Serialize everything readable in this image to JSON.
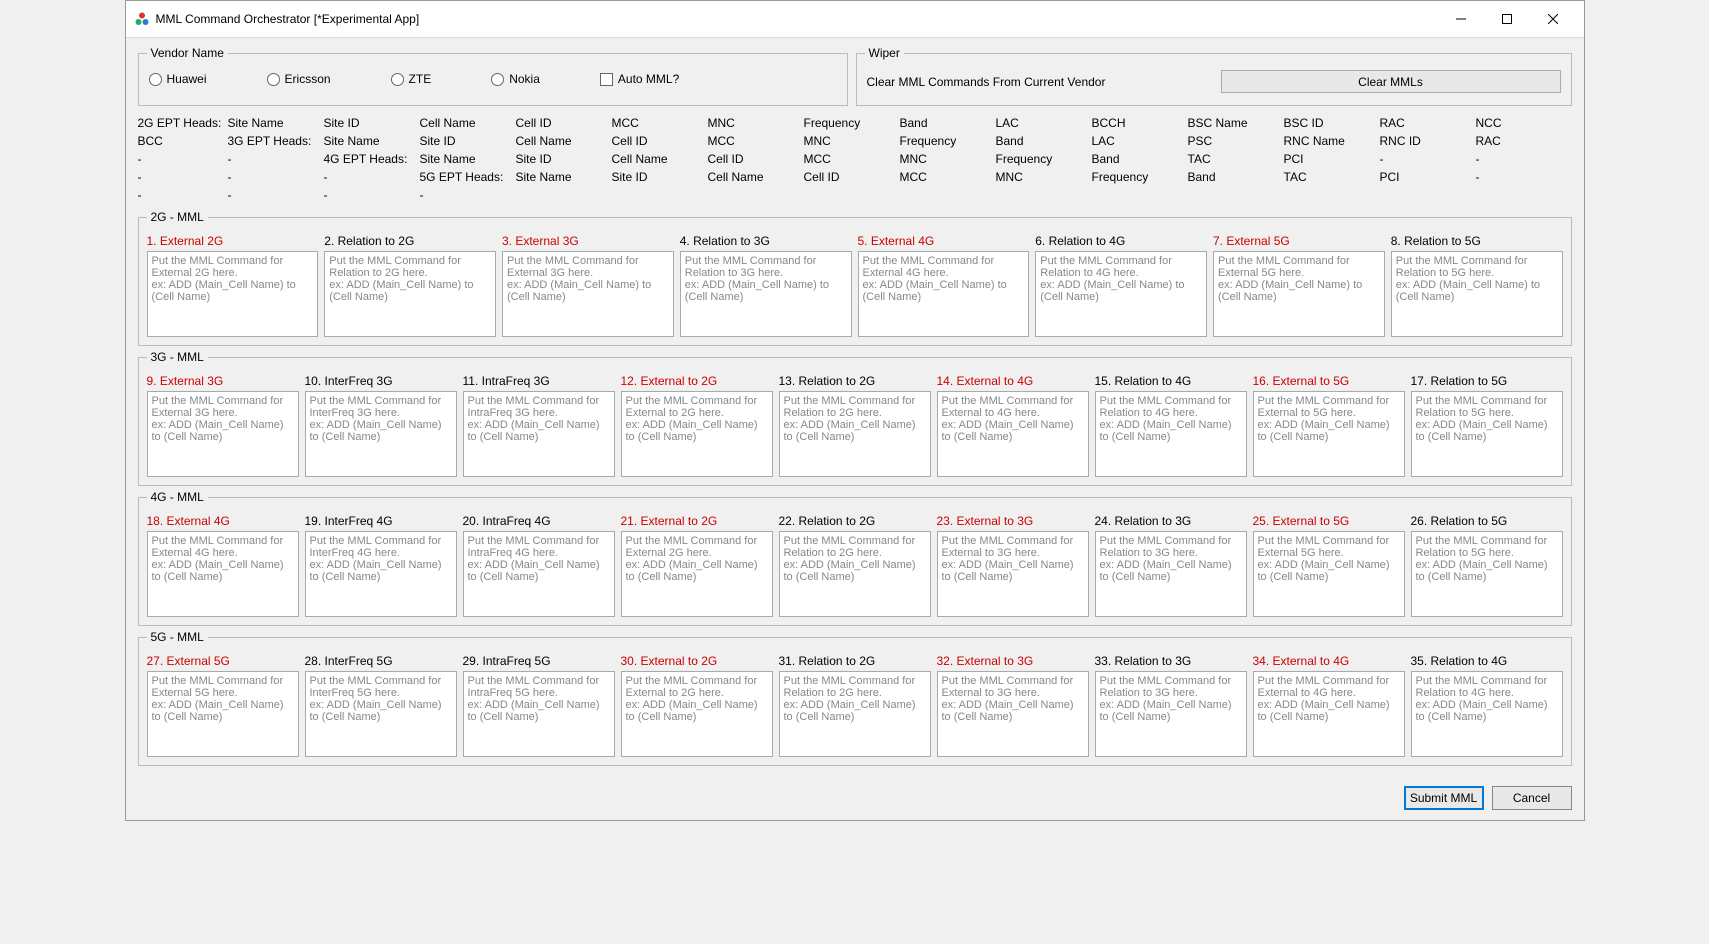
{
  "window": {
    "title": "MML Command Orchestrator [*Experimental App]"
  },
  "vendor": {
    "legend": "Vendor Name",
    "options": [
      "Huawei",
      "Ericsson",
      "ZTE",
      "Nokia"
    ],
    "auto_label": "Auto MML?"
  },
  "wiper": {
    "legend": "Wiper",
    "text": "Clear MML Commands From Current Vendor",
    "button": "Clear MMLs"
  },
  "heads": {
    "rows": [
      {
        "label": "2G EPT Heads:",
        "cols": [
          "Site Name",
          "Site ID",
          "Cell Name",
          "Cell ID",
          "MCC",
          "MNC",
          "Frequency",
          "Band",
          "LAC",
          "BCCH",
          "BSC Name",
          "BSC ID",
          "RAC",
          "NCC",
          "BCC"
        ]
      },
      {
        "label": "3G EPT Heads:",
        "cols": [
          "Site Name",
          "Site ID",
          "Cell Name",
          "Cell ID",
          "MCC",
          "MNC",
          "Frequency",
          "Band",
          "LAC",
          "PSC",
          "RNC Name",
          "RNC ID",
          "RAC",
          "-",
          "-"
        ]
      },
      {
        "label": "4G EPT Heads:",
        "cols": [
          "Site Name",
          "Site ID",
          "Cell Name",
          "Cell ID",
          "MCC",
          "MNC",
          "Frequency",
          "Band",
          "TAC",
          "PCI",
          "-",
          "-",
          "-",
          "-",
          "-"
        ]
      },
      {
        "label": "5G EPT Heads:",
        "cols": [
          "Site Name",
          "Site ID",
          "Cell Name",
          "Cell ID",
          "MCC",
          "MNC",
          "Frequency",
          "Band",
          "TAC",
          "PCI",
          "-",
          "-",
          "-",
          "-",
          "-"
        ]
      }
    ]
  },
  "sections": [
    {
      "legend": "2G - MML",
      "items": [
        {
          "label": "1. External 2G",
          "red": true,
          "placeholder": "Put the MML Command for External 2G here.\nex: ADD (Main_Cell Name) to (Cell Name)"
        },
        {
          "label": "2. Relation to 2G",
          "red": false,
          "placeholder": "Put the MML Command for Relation to 2G here.\nex: ADD (Main_Cell Name) to (Cell Name)"
        },
        {
          "label": "3. External 3G",
          "red": true,
          "placeholder": "Put the MML Command for External 3G here.\nex: ADD (Main_Cell Name) to (Cell Name)"
        },
        {
          "label": "4. Relation to 3G",
          "red": false,
          "placeholder": "Put the MML Command for Relation to 3G here.\nex: ADD (Main_Cell Name) to (Cell Name)"
        },
        {
          "label": "5. External 4G",
          "red": true,
          "placeholder": "Put the MML Command for External 4G here.\nex: ADD (Main_Cell Name) to (Cell Name)"
        },
        {
          "label": "6. Relation to 4G",
          "red": false,
          "placeholder": "Put the MML Command for Relation to 4G here.\nex: ADD (Main_Cell Name) to (Cell Name)"
        },
        {
          "label": "7. External 5G",
          "red": true,
          "placeholder": "Put the MML Command for External 5G here.\nex: ADD (Main_Cell Name) to (Cell Name)"
        },
        {
          "label": "8. Relation to 5G",
          "red": false,
          "placeholder": "Put the MML Command for Relation to 5G here.\nex: ADD (Main_Cell Name) to (Cell Name)"
        }
      ]
    },
    {
      "legend": "3G - MML",
      "items": [
        {
          "label": "9. External 3G",
          "red": true,
          "placeholder": "Put the MML Command for External 3G here.\nex: ADD (Main_Cell Name) to (Cell Name)"
        },
        {
          "label": "10. InterFreq 3G",
          "red": false,
          "placeholder": "Put the MML Command for InterFreq 3G here.\nex: ADD (Main_Cell Name) to (Cell Name)"
        },
        {
          "label": "11. IntraFreq 3G",
          "red": false,
          "placeholder": "Put the MML Command for IntraFreq 3G here.\nex: ADD (Main_Cell Name) to (Cell Name)"
        },
        {
          "label": "12. External to 2G",
          "red": true,
          "placeholder": "Put the MML Command for External to 2G here.\nex: ADD (Main_Cell Name) to (Cell Name)"
        },
        {
          "label": "13. Relation to 2G",
          "red": false,
          "placeholder": "Put the MML Command for Relation to 2G here.\nex: ADD (Main_Cell Name) to (Cell Name)"
        },
        {
          "label": "14. External to 4G",
          "red": true,
          "placeholder": "Put the MML Command for External to 4G here.\nex: ADD (Main_Cell Name) to (Cell Name)"
        },
        {
          "label": "15. Relation to 4G",
          "red": false,
          "placeholder": "Put the MML Command for Relation to 4G here.\nex: ADD (Main_Cell Name) to (Cell Name)"
        },
        {
          "label": "16. External to 5G",
          "red": true,
          "placeholder": "Put the MML Command for External to 5G here.\nex: ADD (Main_Cell Name) to (Cell Name)"
        },
        {
          "label": "17. Relation to 5G",
          "red": false,
          "placeholder": "Put the MML Command for Relation to 5G here.\nex: ADD (Main_Cell Name) to (Cell Name)"
        }
      ]
    },
    {
      "legend": "4G - MML",
      "items": [
        {
          "label": "18. External 4G",
          "red": true,
          "placeholder": "Put the MML Command for External 4G here.\nex: ADD (Main_Cell Name) to (Cell Name)"
        },
        {
          "label": "19. InterFreq 4G",
          "red": false,
          "placeholder": "Put the MML Command for InterFreq 4G here.\nex: ADD (Main_Cell Name) to (Cell Name)"
        },
        {
          "label": "20. IntraFreq 4G",
          "red": false,
          "placeholder": "Put the MML Command for IntraFreq 4G here.\nex: ADD (Main_Cell Name) to (Cell Name)"
        },
        {
          "label": "21. External to 2G",
          "red": true,
          "placeholder": "Put the MML Command for External 2G here.\nex: ADD (Main_Cell Name) to (Cell Name)"
        },
        {
          "label": "22. Relation to 2G",
          "red": false,
          "placeholder": "Put the MML Command for Relation to 2G here.\nex: ADD (Main_Cell Name) to (Cell Name)"
        },
        {
          "label": "23. External to 3G",
          "red": true,
          "placeholder": "Put the MML Command for External to 3G here.\nex: ADD (Main_Cell Name) to (Cell Name)"
        },
        {
          "label": "24. Relation to 3G",
          "red": false,
          "placeholder": "Put the MML Command for Relation to 3G here.\nex: ADD (Main_Cell Name) to (Cell Name)"
        },
        {
          "label": "25. External to 5G",
          "red": true,
          "placeholder": "Put the MML Command for External 5G here.\nex: ADD (Main_Cell Name) to (Cell Name)"
        },
        {
          "label": "26. Relation to 5G",
          "red": false,
          "placeholder": "Put the MML Command for Relation to 5G here.\nex: ADD (Main_Cell Name) to (Cell Name)"
        }
      ]
    },
    {
      "legend": "5G - MML",
      "items": [
        {
          "label": "27. External 5G",
          "red": true,
          "placeholder": "Put the MML Command for External 5G here.\nex: ADD (Main_Cell Name) to (Cell Name)"
        },
        {
          "label": "28. InterFreq 5G",
          "red": false,
          "placeholder": "Put the MML Command for InterFreq 5G here.\nex: ADD (Main_Cell Name) to (Cell Name)"
        },
        {
          "label": "29. IntraFreq 5G",
          "red": false,
          "placeholder": "Put the MML Command for IntraFreq 5G here.\nex: ADD (Main_Cell Name) to (Cell Name)"
        },
        {
          "label": "30. External to 2G",
          "red": true,
          "placeholder": "Put the MML Command for External to 2G here.\nex: ADD (Main_Cell Name) to (Cell Name)"
        },
        {
          "label": "31. Relation to 2G",
          "red": false,
          "placeholder": "Put the MML Command for Relation to 2G here.\nex: ADD (Main_Cell Name) to (Cell Name)"
        },
        {
          "label": "32. External to 3G",
          "red": true,
          "placeholder": "Put the MML Command for External to 3G here.\nex: ADD (Main_Cell Name) to (Cell Name)"
        },
        {
          "label": "33. Relation to 3G",
          "red": false,
          "placeholder": "Put the MML Command for Relation to 3G here.\nex: ADD (Main_Cell Name) to (Cell Name)"
        },
        {
          "label": "34. External to 4G",
          "red": true,
          "placeholder": "Put the MML Command for External to 4G here.\nex: ADD (Main_Cell Name) to (Cell Name)"
        },
        {
          "label": "35. Relation to 4G",
          "red": false,
          "placeholder": "Put the MML Command for Relation to 4G here.\nex: ADD (Main_Cell Name) to (Cell Name)"
        }
      ]
    }
  ],
  "footer": {
    "submit": "Submit MML",
    "cancel": "Cancel"
  }
}
